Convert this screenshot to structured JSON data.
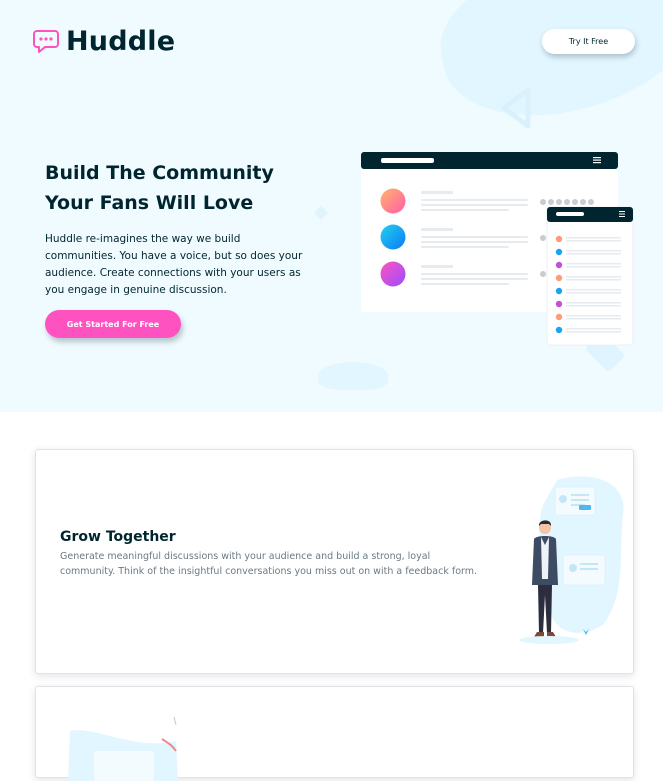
{
  "header": {
    "brand": "Huddle",
    "logo_icon": "chat-bubble-icon",
    "cta_label": "Try It Free"
  },
  "hero": {
    "title": "Build The Community Your Fans Will Love",
    "text": "Huddle re-imagines the way we build communities. You have a voice, but so does your audience. Create connections with your users as you engage in genuine discussion.",
    "button_label": "Get Started For Free"
  },
  "features": [
    {
      "title": "Grow Together",
      "text": "Generate meaningful discussions with your audience and build a strong, loyal community. Think of the insightful conversations you miss out on with a feedback form."
    }
  ],
  "colors": {
    "dark_navy": "#00252e",
    "pink": "#ff52c1",
    "hero_background": "#f0fbff",
    "muted_text": "#6a7a86"
  }
}
